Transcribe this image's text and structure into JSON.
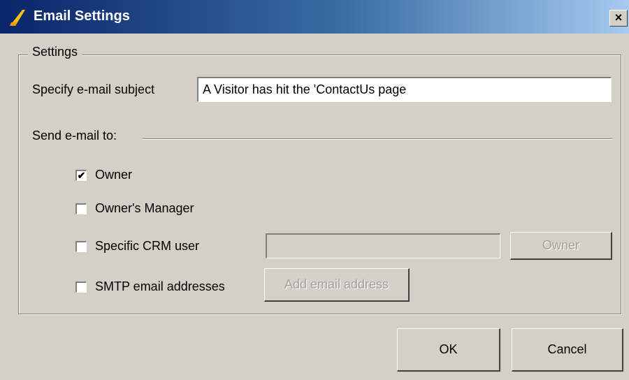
{
  "window": {
    "title": "Email Settings",
    "close_label": "×"
  },
  "settings_group": {
    "label": "Settings"
  },
  "subject": {
    "label": "Specify e-mail subject",
    "value": "A Visitor has hit the 'ContactUs page"
  },
  "send_to": {
    "label": "Send e-mail to:",
    "owner": {
      "label": "Owner",
      "checked": true,
      "mark": "✔"
    },
    "owners_manager": {
      "label": "Owner's Manager",
      "checked": false
    },
    "specific_crm_user": {
      "label": "Specific CRM user",
      "checked": false,
      "value": "",
      "button_label": "Owner"
    },
    "smtp": {
      "label": "SMTP email addresses",
      "checked": false,
      "button_label": "Add email address"
    }
  },
  "buttons": {
    "ok": "OK",
    "cancel": "Cancel"
  }
}
